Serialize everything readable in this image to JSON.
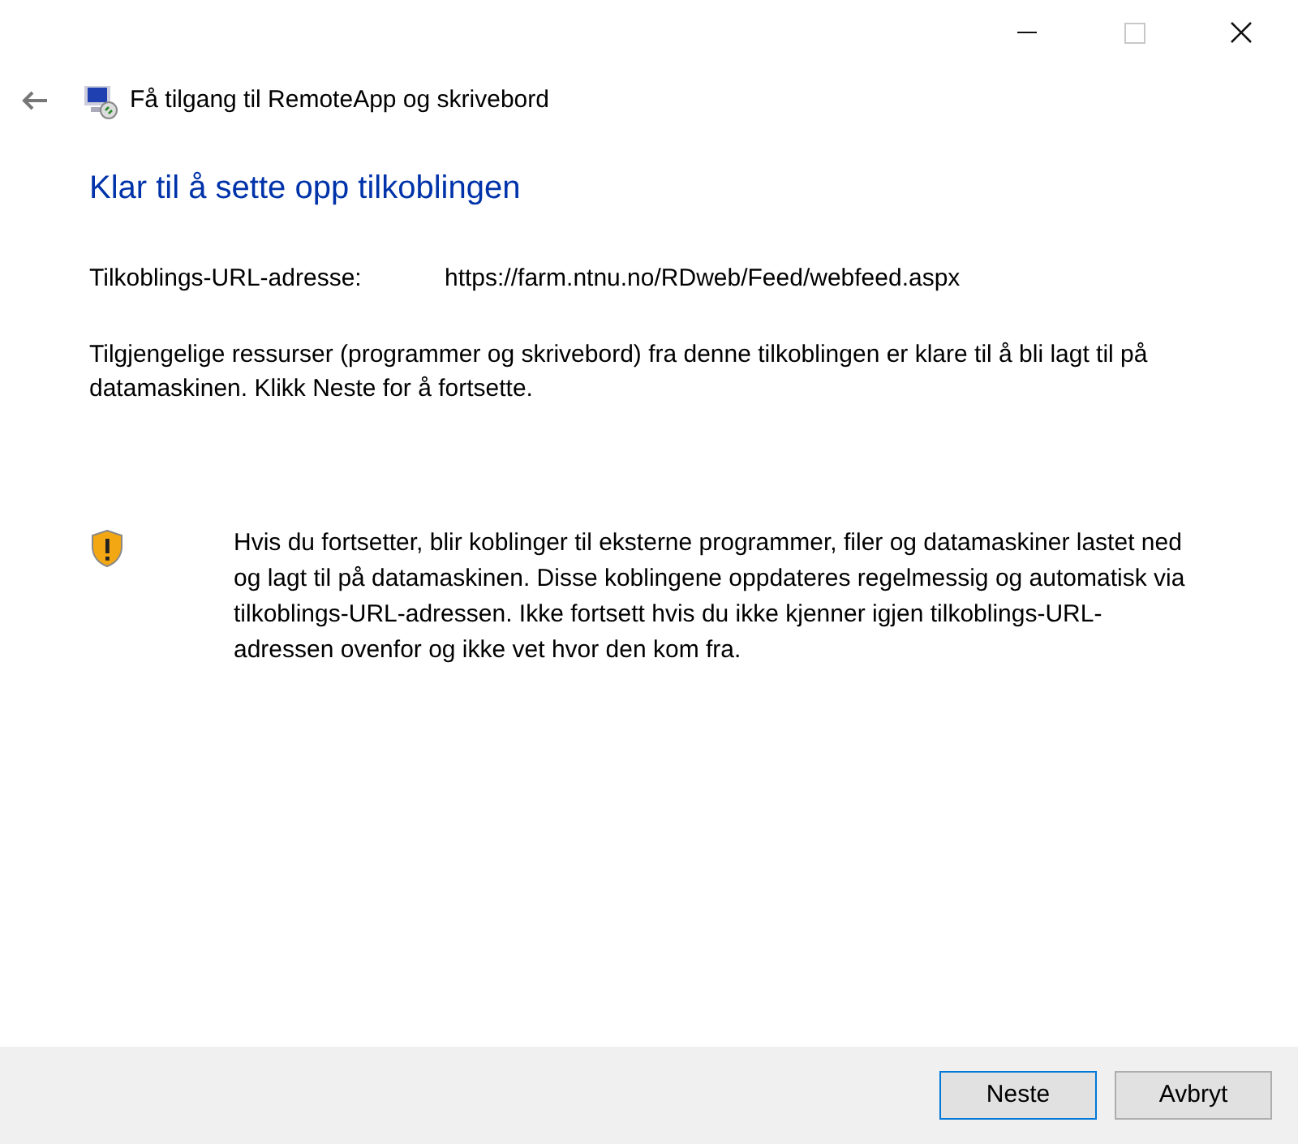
{
  "window": {
    "maximize_disabled": true
  },
  "header": {
    "title": "Få tilgang til RemoteApp og skrivebord"
  },
  "heading": "Klar til å sette opp tilkoblingen",
  "url_row": {
    "label": "Tilkoblings-URL-adresse:",
    "value": "https://farm.ntnu.no/RDweb/Feed/webfeed.aspx"
  },
  "description": "Tilgjengelige ressurser (programmer og skrivebord) fra denne tilkoblingen er klare til å bli lagt til på datamaskinen. Klikk Neste for å fortsette.",
  "warning": "Hvis du fortsetter, blir koblinger til eksterne programmer, filer og datamaskiner lastet ned og lagt til på datamaskinen. Disse koblingene oppdateres regelmessig og automatisk via tilkoblings-URL-adressen. Ikke fortsett hvis du ikke kjenner igjen tilkoblings-URL-adressen ovenfor og ikke vet hvor den kom fra.",
  "buttons": [
    {
      "label": "Neste",
      "default": true
    },
    {
      "label": "Avbryt",
      "default": false
    }
  ]
}
